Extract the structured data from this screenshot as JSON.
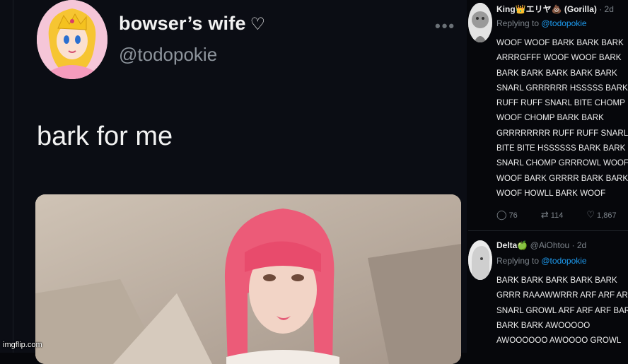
{
  "tweet": {
    "display_name": "bowser’s wife",
    "heart_glyph": "♡",
    "handle": "@todopokie",
    "more_glyph": "•••",
    "text": "bark for me",
    "avatar_icon": "princess-peach-avatar",
    "media_icon": "pink-hair-photo"
  },
  "replies": [
    {
      "name": "King👑エリヤ💩 (Gorilla)",
      "meta": " · 2d",
      "replying_prefix": "Replying to ",
      "replying_handle": "@todopokie",
      "lines": [
        "WOOF WOOF BARK BARK BARK",
        "ARRRGFFF WOOF WOOF BARK",
        "BARK BARK BARK BARK BARK",
        "SNARL GRRRRRR HSSSSS BARK",
        "RUFF RUFF SNARL BITE CHOMP",
        "WOOF CHOMP BARK BARK",
        "GRRRRRRRR RUFF RUFF SNARL",
        "BITE BITE HSSSSSS BARK BARK",
        "SNARL CHOMP gRRROWL WOOF",
        "WOOF BARK GRRRR BARK BARK",
        "WOOF HOWLL BARK WOOF"
      ],
      "stats": {
        "replies": "76",
        "retweets": "114",
        "likes": "1,867"
      }
    },
    {
      "name": "Delta🍏",
      "meta": " @AiOhtou · 2d",
      "replying_prefix": "Replying to ",
      "replying_handle": "@todopokie",
      "lines": [
        "BARK BARK BARK BARK BARK",
        "GRRR RAAAWWRRR ARF ARF ARF",
        "SNARL GROWL ARF ARF ARF BARK",
        "BARK BARK AWOOOOO",
        "AWOOOOOO AWOOOO GROWL"
      ]
    }
  ],
  "watermark": "imgflip.com",
  "colors": {
    "background": "#0b0d14",
    "mention": "#1d9bf0",
    "muted": "#7e858c",
    "hair": "#ec5b78"
  }
}
